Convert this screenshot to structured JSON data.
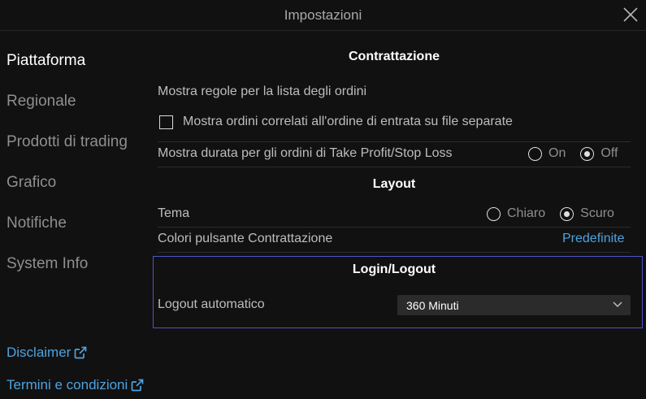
{
  "window": {
    "title": "Impostazioni"
  },
  "sidebar": {
    "items": [
      {
        "label": "Piattaforma",
        "active": true
      },
      {
        "label": "Regionale"
      },
      {
        "label": "Prodotti di trading"
      },
      {
        "label": "Grafico"
      },
      {
        "label": "Notifiche"
      },
      {
        "label": "System Info"
      }
    ],
    "links": [
      {
        "label": "Disclaimer",
        "icon": "external-link-icon"
      },
      {
        "label": "Termini e condizioni",
        "icon": "external-link-icon"
      }
    ]
  },
  "trading": {
    "title": "Contrattazione",
    "rules_label": "Mostra regole per la lista degli ordini",
    "related_orders_label": "Mostra ordini correlati all'ordine di entrata su file separate",
    "related_orders_checked": false,
    "duration_label": "Mostra durata per gli ordini di Take Profit/Stop Loss",
    "duration_on": "On",
    "duration_off": "Off",
    "duration_selected": "Off"
  },
  "layout": {
    "title": "Layout",
    "theme_label": "Tema",
    "theme_light": "Chiaro",
    "theme_dark": "Scuro",
    "theme_selected": "Scuro",
    "button_colors_label": "Colori pulsante Contrattazione",
    "button_colors_link": "Predefinite"
  },
  "login": {
    "title": "Login/Logout",
    "auto_logout_label": "Logout automatico",
    "auto_logout_value": "360 Minuti"
  },
  "colors": {
    "background": "#111111",
    "link": "#4da3e0",
    "focus_border": "#4f55c7"
  }
}
